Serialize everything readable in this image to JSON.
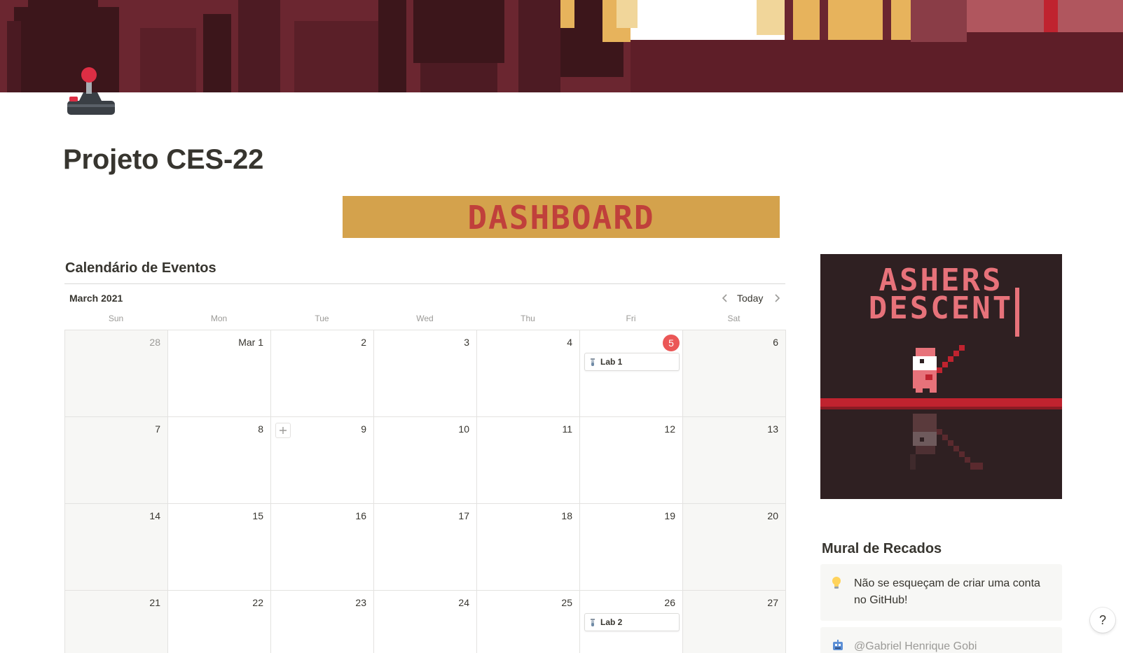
{
  "page": {
    "title": "Projeto CES-22",
    "icon": "joystick-icon",
    "banner_text": "DASHBOARD",
    "banner_color": "#d4a24c"
  },
  "calendar": {
    "heading": "Calendário de Eventos",
    "month_label": "March 2021",
    "today_label": "Today",
    "today_color": "#eb5757",
    "weekdays": [
      "Sun",
      "Mon",
      "Tue",
      "Wed",
      "Thu",
      "Fri",
      "Sat"
    ],
    "weeks": [
      [
        "28",
        "Mar 1",
        "2",
        "3",
        "4",
        "5",
        "6"
      ],
      [
        "7",
        "8",
        "9",
        "10",
        "11",
        "12",
        "13"
      ],
      [
        "14",
        "15",
        "16",
        "17",
        "18",
        "19",
        "20"
      ],
      [
        "21",
        "22",
        "23",
        "24",
        "25",
        "26",
        "27"
      ]
    ],
    "events": {
      "lab1": {
        "label": "Lab 1",
        "icon": "test-tube-icon"
      },
      "lab2": {
        "label": "Lab 2",
        "icon": "test-tube-icon"
      }
    }
  },
  "game_art": {
    "line1": "ASHERS",
    "line2": "DESCENT"
  },
  "mural": {
    "heading": "Mural de Recados",
    "notes": [
      {
        "icon": "lightbulb-icon",
        "text": "Não se esqueçam de criar uma conta no GitHub!"
      },
      {
        "icon": "robot-icon",
        "text": "@Gabriel Henrique Gobi"
      }
    ]
  },
  "help": {
    "label": "?"
  }
}
